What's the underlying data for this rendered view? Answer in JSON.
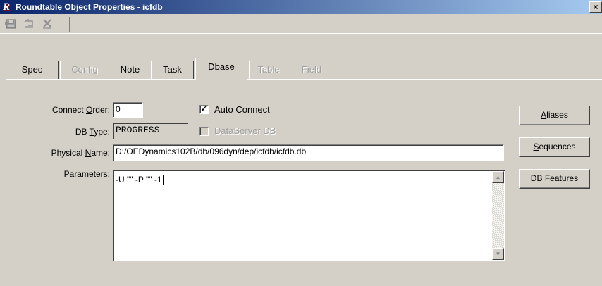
{
  "window": {
    "title": "Roundtable Object Properties - icfdb",
    "app_icon_letter": "R",
    "close_glyph": "×"
  },
  "toolbar": {
    "buttons": [
      {
        "icon": "save-icon"
      },
      {
        "icon": "undo-icon"
      },
      {
        "icon": "delete-icon"
      }
    ]
  },
  "tabs": [
    {
      "label": "Spec",
      "state": "normal"
    },
    {
      "label": "Config",
      "state": "disabled"
    },
    {
      "label": "Note",
      "state": "normal"
    },
    {
      "label": "Task",
      "state": "normal"
    },
    {
      "label": "Dbase",
      "state": "active"
    },
    {
      "label": "Table",
      "state": "disabled"
    },
    {
      "label": "Field",
      "state": "disabled"
    }
  ],
  "form": {
    "connect_order": {
      "label_pre": "Connect ",
      "label_key": "O",
      "label_post": "rder:",
      "value": "0"
    },
    "auto_connect": {
      "label": "Auto Connect",
      "checked": true
    },
    "db_type": {
      "label_pre": "DB ",
      "label_key": "T",
      "label_post": "ype:",
      "value": "PROGRESS"
    },
    "dataserver_db": {
      "label": "DataServer DB",
      "checked": false,
      "disabled": true
    },
    "physical_name": {
      "label_pre": "Physical ",
      "label_key": "N",
      "label_post": "ame:",
      "value": "D:/OEDynamics102B/db/096dyn/dep/icfdb/icfdb.db"
    },
    "parameters": {
      "label_pre": "",
      "label_key": "P",
      "label_post": "arameters:",
      "value": "-U \"\" -P \"\" -1"
    }
  },
  "side_buttons": {
    "aliases": {
      "pre": "",
      "key": "A",
      "post": "liases"
    },
    "sequences": {
      "pre": "",
      "key": "S",
      "post": "equences"
    },
    "db_features": {
      "pre": "DB ",
      "key": "F",
      "post": "eatures"
    }
  },
  "colors": {
    "title_gradient_start": "#0a246a",
    "title_gradient_end": "#a6caf0",
    "face": "#d4d0c8"
  }
}
